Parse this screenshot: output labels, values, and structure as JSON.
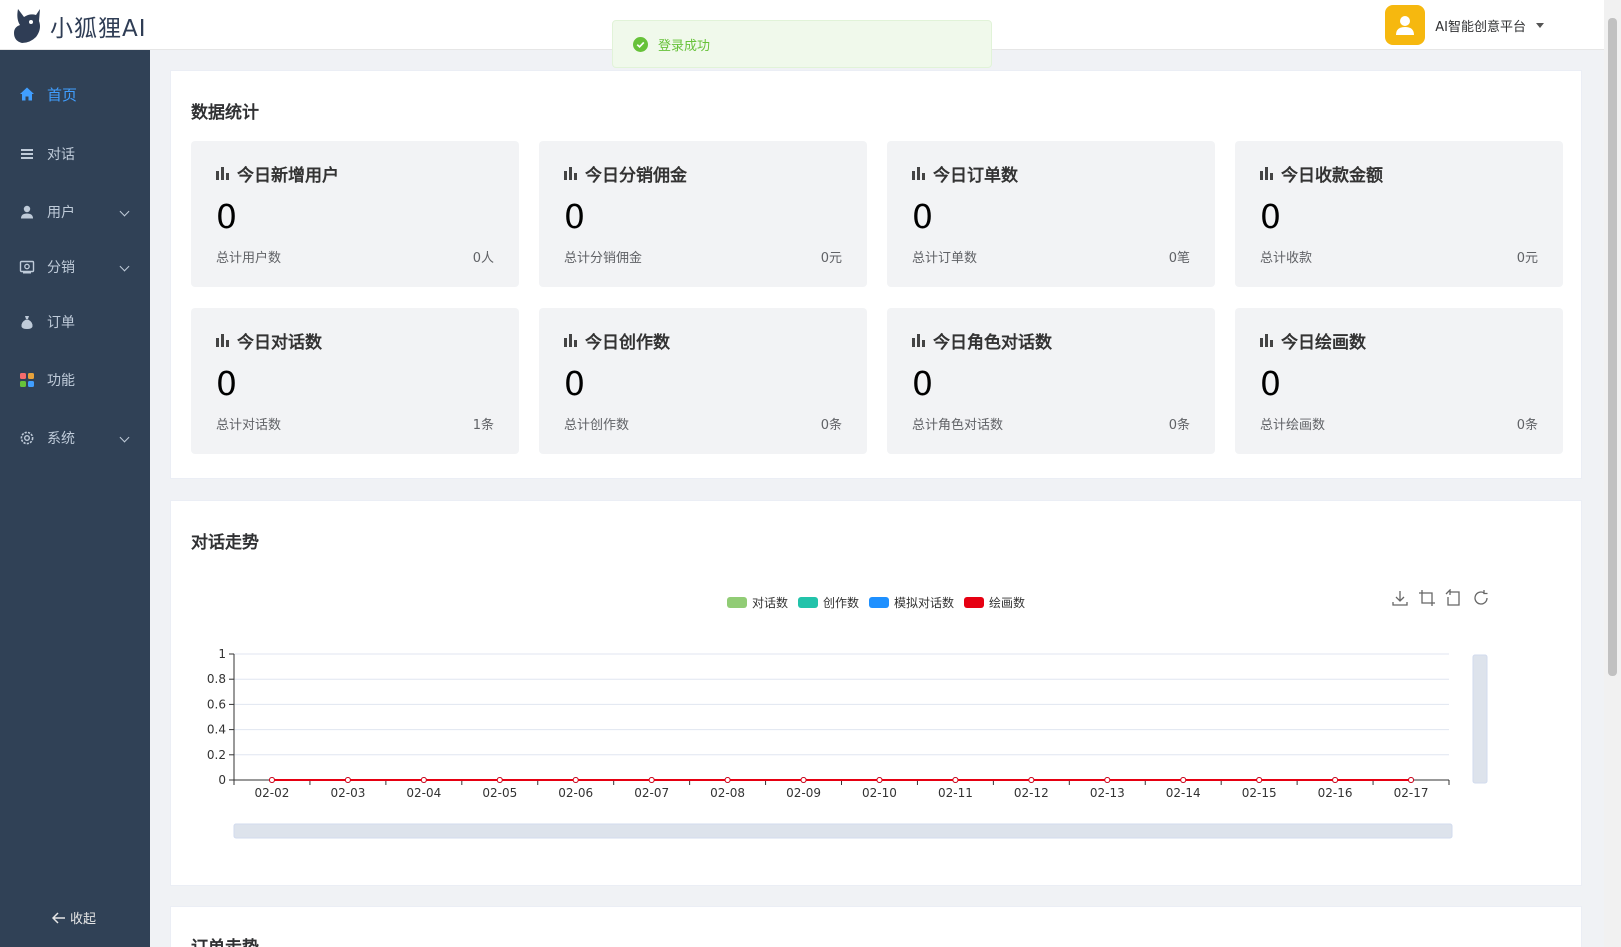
{
  "app": {
    "logo_text": "小狐狸AI",
    "user_name": "AI智能创意平台"
  },
  "toast": {
    "message": "登录成功"
  },
  "sidebar": {
    "items": [
      {
        "label": "首页",
        "icon": "home-icon",
        "active": true
      },
      {
        "label": "对话",
        "icon": "list-icon"
      },
      {
        "label": "用户",
        "icon": "user-icon",
        "expandable": true
      },
      {
        "label": "分销",
        "icon": "share-icon",
        "expandable": true
      },
      {
        "label": "订单",
        "icon": "money-bag-icon"
      },
      {
        "label": "功能",
        "icon": "apps-icon"
      },
      {
        "label": "系统",
        "icon": "gear-icon",
        "expandable": true
      }
    ],
    "collapse_label": "收起"
  },
  "stats": {
    "title": "数据统计",
    "cards": [
      {
        "title": "今日新增用户",
        "value": "0",
        "foot": "总计用户数",
        "total": "0人"
      },
      {
        "title": "今日分销佣金",
        "value": "0",
        "foot": "总计分销佣金",
        "total": "0元"
      },
      {
        "title": "今日订单数",
        "value": "0",
        "foot": "总计订单数",
        "total": "0笔"
      },
      {
        "title": "今日收款金额",
        "value": "0",
        "foot": "总计收款",
        "total": "0元"
      },
      {
        "title": "今日对话数",
        "value": "0",
        "foot": "总计对话数",
        "total": "1条"
      },
      {
        "title": "今日创作数",
        "value": "0",
        "foot": "总计创作数",
        "total": "0条"
      },
      {
        "title": "今日角色对话数",
        "value": "0",
        "foot": "总计角色对话数",
        "total": "0条"
      },
      {
        "title": "今日绘画数",
        "value": "0",
        "foot": "总计绘画数",
        "total": "0条"
      }
    ]
  },
  "trend": {
    "title": "对话走势"
  },
  "order_trend": {
    "title": "订单走势"
  },
  "chart_data": {
    "type": "line",
    "x": [
      "02-02",
      "02-03",
      "02-04",
      "02-05",
      "02-06",
      "02-07",
      "02-08",
      "02-09",
      "02-10",
      "02-11",
      "02-12",
      "02-13",
      "02-14",
      "02-15",
      "02-16",
      "02-17"
    ],
    "series": [
      {
        "name": "对话数",
        "color": "#91cc75",
        "values": [
          0,
          0,
          0,
          0,
          0,
          0,
          0,
          0,
          0,
          0,
          0,
          0,
          0,
          0,
          0,
          0
        ]
      },
      {
        "name": "创作数",
        "color": "#22c3aa",
        "values": [
          0,
          0,
          0,
          0,
          0,
          0,
          0,
          0,
          0,
          0,
          0,
          0,
          0,
          0,
          0,
          0
        ]
      },
      {
        "name": "模拟对话数",
        "color": "#1e90ff",
        "values": [
          0,
          0,
          0,
          0,
          0,
          0,
          0,
          0,
          0,
          0,
          0,
          0,
          0,
          0,
          0,
          0
        ]
      },
      {
        "name": "绘画数",
        "color": "#e60012",
        "values": [
          0,
          0,
          0,
          0,
          0,
          0,
          0,
          0,
          0,
          0,
          0,
          0,
          0,
          0,
          0,
          0
        ]
      }
    ],
    "yticks": [
      "0",
      "0.2",
      "0.4",
      "0.6",
      "0.8",
      "1"
    ],
    "ylim": [
      0,
      1
    ],
    "grid": true,
    "legend": "top-center"
  }
}
